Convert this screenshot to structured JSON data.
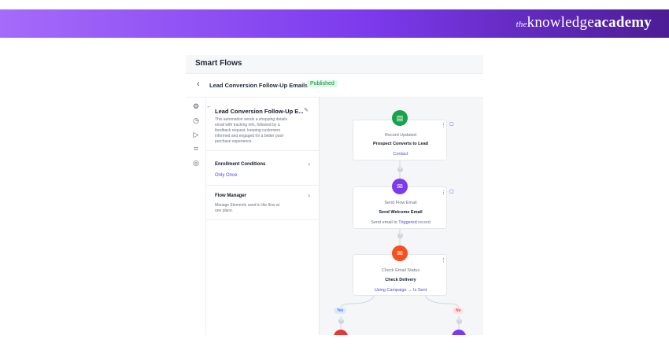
{
  "banner": {
    "brand_prefix": "the",
    "brand_mid": "knowledge",
    "brand_bold": "academy"
  },
  "header": {
    "app_title": "Smart Flows"
  },
  "flow": {
    "title": "Lead Conversion Follow-Up Emails",
    "status": "Published"
  },
  "sidebar_icons": [
    "gear-icon",
    "history-icon",
    "play-icon",
    "scan-icon",
    "palette-icon"
  ],
  "panel": {
    "title": "Lead Conversion Follow-Up E...",
    "description_lines": [
      "This automation sends a shopping details",
      "email with tracking info, followed by a",
      "feedback request, keeping customers",
      "informed and engaged for a better post-",
      "purchase experience."
    ],
    "enrollment": {
      "title": "Enrollment Conditions",
      "value": "Only Once"
    },
    "manager": {
      "title": "Flow Manager",
      "desc_lines": [
        "Manage Elements used in the flow at",
        "one place."
      ]
    }
  },
  "nodes": [
    {
      "type": "Record Updated",
      "name": "Prospect Converts to Lead",
      "detail": "Contact",
      "color": "#16a34a",
      "icon": "document-icon"
    },
    {
      "type": "Send Flow Email",
      "name": "Send Welcome Email",
      "detail_prefix": "Send email to ",
      "detail_link": "Triggered",
      "detail_suffix": " record",
      "color": "#7c3aed",
      "icon": "mail-icon"
    },
    {
      "type": "Check Email Status",
      "name": "Check Delivery",
      "detail_prefix": "Using Campaign → ",
      "detail_link": "Is Sent",
      "color": "#f4511e",
      "icon": "mail-icon"
    }
  ],
  "branches": {
    "yes": "Yes",
    "no": "No"
  },
  "colors": {
    "accent": "#4f46e5",
    "published_bg": "#dcfce7",
    "published_fg": "#15803d"
  }
}
